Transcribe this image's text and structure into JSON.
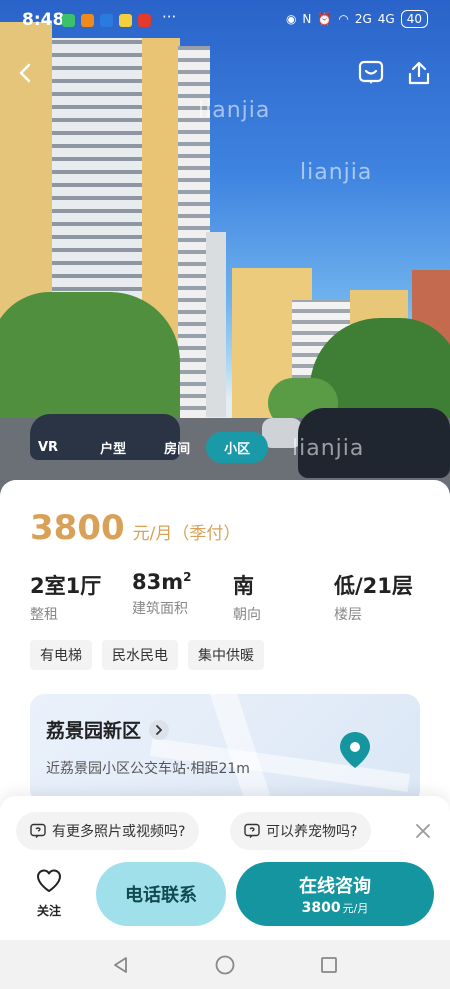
{
  "status_bar": {
    "time": "8:48",
    "more": "···",
    "battery": "40",
    "signal1": "2G",
    "signal2": "4G"
  },
  "hero": {
    "watermark": "lianjia"
  },
  "media_tabs": [
    {
      "label": "VR"
    },
    {
      "label": "户型"
    },
    {
      "label": "房间"
    },
    {
      "label": "小区",
      "active": true
    }
  ],
  "listing": {
    "price": "3800",
    "price_unit": "元/月（季付）",
    "stats": [
      {
        "value": "2室1厅",
        "key": "整租"
      },
      {
        "value": "83m",
        "sup": "2",
        "key": "建筑面积"
      },
      {
        "value": "南",
        "key": "朝向"
      },
      {
        "value": "低/21层",
        "key": "楼层"
      }
    ],
    "tags": [
      "有电梯",
      "民水民电",
      "集中供暖"
    ]
  },
  "community": {
    "name": "荔景园新区",
    "nearby": "近荔景园小区公交车站·相距21m"
  },
  "questions": [
    "有更多照片或视频吗?",
    "可以养宠物吗?"
  ],
  "actions": {
    "favorite": "关注",
    "call": "电话联系",
    "chat": "在线咨询",
    "chat_price": "3800",
    "chat_price_unit": "元/月"
  },
  "colors": {
    "accent": "#15959f",
    "price": "#d8a158",
    "call_bg": "#9fe0ea"
  }
}
